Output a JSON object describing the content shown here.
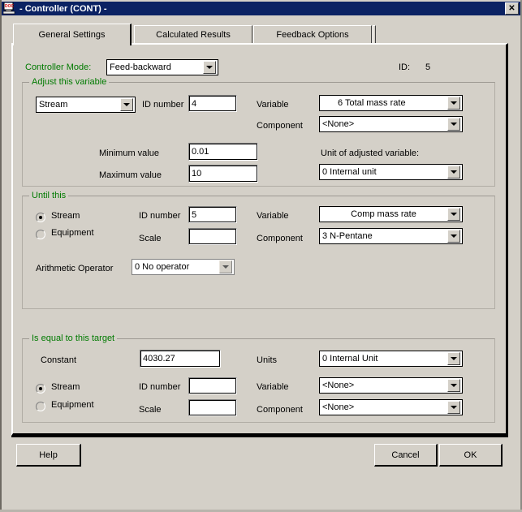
{
  "window": {
    "title": "- Controller (CONT) -",
    "icon": "document-app-icon",
    "close_label": "✕",
    "titlebar_color": "#0b2263",
    "face_color": "#d4d0c8",
    "group_label_color": "#007a00"
  },
  "tabs": [
    {
      "label": "General Settings",
      "selected": true
    },
    {
      "label": "Calculated Results",
      "selected": false
    },
    {
      "label": "Feedback Options",
      "selected": false
    }
  ],
  "header": {
    "controller_mode_label": "Controller Mode:",
    "controller_mode_value": "Feed-backward",
    "id_label": "ID:",
    "id_value": "5"
  },
  "adjust_group": {
    "title": "Adjust this variable",
    "object_type_value": "Stream",
    "id_number_label": "ID number",
    "id_number_value": "4",
    "variable_label": "Variable",
    "variable_value": "6 Total mass rate",
    "component_label": "Component",
    "component_value": "<None>",
    "minimum_label": "Minimum  value",
    "minimum_value": "0.01",
    "maximum_label": "Maximum  value",
    "maximum_value": "10",
    "unit_label": "Unit of adjusted variable:",
    "unit_value": "0  Internal unit"
  },
  "until_group": {
    "title": "Until this",
    "stream_label": "Stream",
    "equipment_label": "Equipment",
    "stream_selected": true,
    "id_number_label": "ID number",
    "id_number_value": "5",
    "scale_label": "Scale",
    "scale_value": "",
    "variable_label": "Variable",
    "variable_value": "Comp mass rate",
    "component_label": "Component",
    "component_value": "3 N-Pentane",
    "arithmetic_label": "Arithmetic Operator",
    "arithmetic_value": "0 No operator"
  },
  "target_group": {
    "title": "Is equal to this target",
    "constant_label": "Constant",
    "constant_value": "4030.27",
    "units_label": "Units",
    "units_value": "0  Internal Unit",
    "stream_label": "Stream",
    "equipment_label": "Equipment",
    "stream_selected": true,
    "id_number_label": "ID number",
    "id_number_value": "",
    "scale_label": "Scale",
    "scale_value": "",
    "variable_label": "Variable",
    "variable_value": "<None>",
    "component_label": "Component",
    "component_value": "<None>"
  },
  "footer": {
    "help_label": "Help",
    "cancel_label": "Cancel",
    "ok_label": "OK"
  }
}
